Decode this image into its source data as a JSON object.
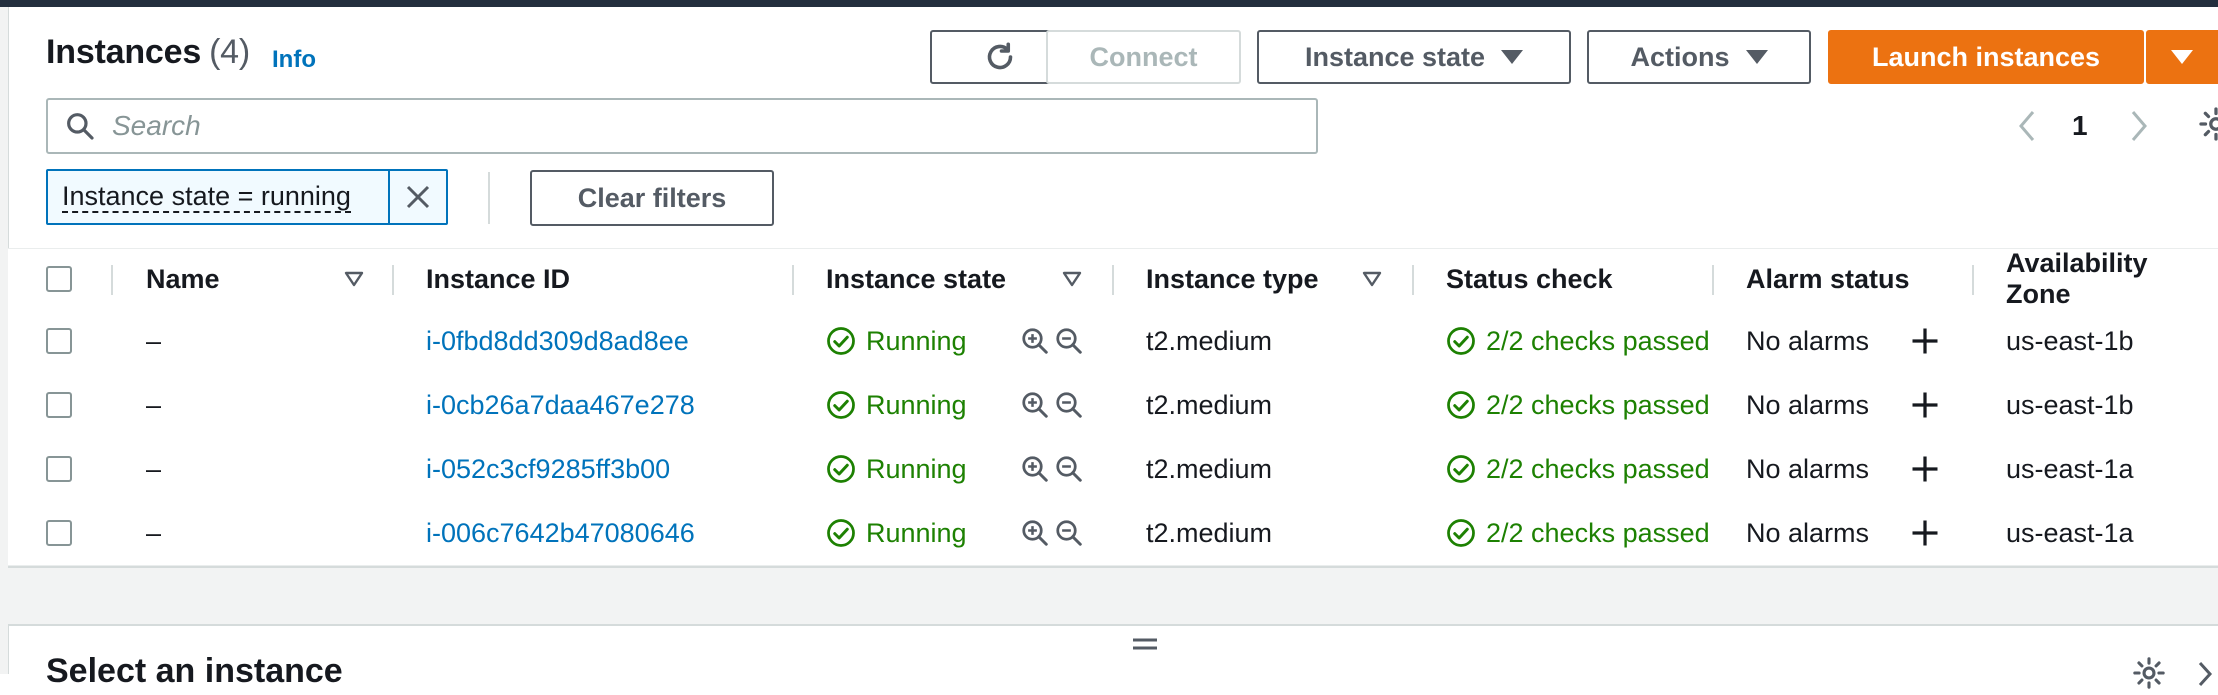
{
  "header": {
    "title": "Instances",
    "count": "(4)",
    "info": "Info"
  },
  "toolbar": {
    "connect": "Connect",
    "instance_state": "Instance state",
    "actions": "Actions",
    "launch": "Launch instances"
  },
  "search": {
    "placeholder": "Search",
    "value": ""
  },
  "pagination": {
    "page": "1"
  },
  "filter": {
    "token": "Instance state = running",
    "clear": "Clear filters"
  },
  "table": {
    "columns": [
      "Name",
      "Instance ID",
      "Instance state",
      "Instance type",
      "Status check",
      "Alarm status",
      "Availability Zone"
    ],
    "rows": [
      {
        "name": "–",
        "id": "i-0fbd8dd309d8ad8ee",
        "state": "Running",
        "type": "t2.medium",
        "status": "2/2 checks passed",
        "alarm": "No alarms",
        "az": "us-east-1b"
      },
      {
        "name": "–",
        "id": "i-0cb26a7daa467e278",
        "state": "Running",
        "type": "t2.medium",
        "status": "2/2 checks passed",
        "alarm": "No alarms",
        "az": "us-east-1b"
      },
      {
        "name": "–",
        "id": "i-052c3cf9285ff3b00",
        "state": "Running",
        "type": "t2.medium",
        "status": "2/2 checks passed",
        "alarm": "No alarms",
        "az": "us-east-1a"
      },
      {
        "name": "–",
        "id": "i-006c7642b47080646",
        "state": "Running",
        "type": "t2.medium",
        "status": "2/2 checks passed",
        "alarm": "No alarms",
        "az": "us-east-1a"
      }
    ]
  },
  "details": {
    "title": "Select an instance"
  },
  "colors": {
    "link": "#0073bb",
    "success": "#1d8102",
    "primary": "#ec7211",
    "topbar": "#232f3e"
  }
}
